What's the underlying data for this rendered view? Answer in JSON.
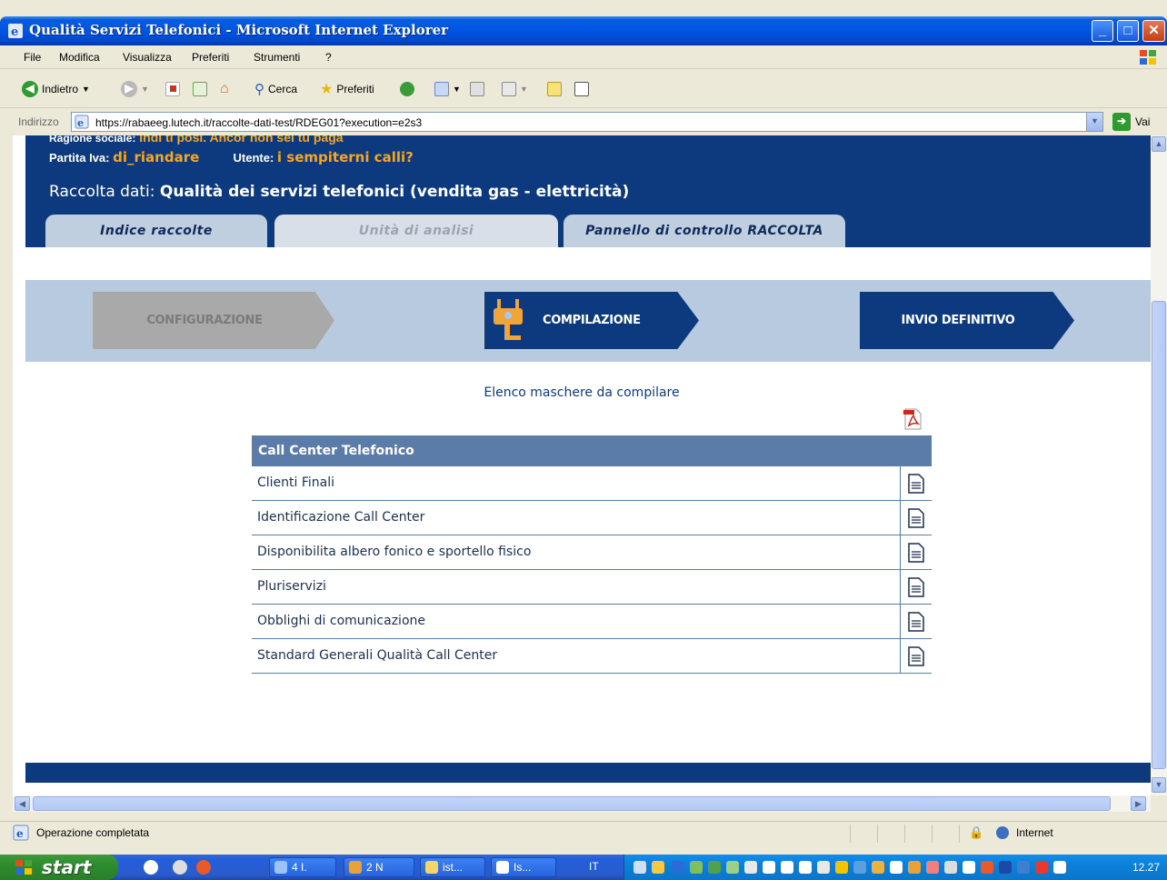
{
  "window": {
    "title": "Qualità Servizi Telefonici - Microsoft Internet Explorer",
    "controls": [
      "_",
      "□",
      "✕"
    ]
  },
  "menu": [
    "File",
    "Modifica",
    "Visualizza",
    "Preferiti",
    "Strumenti",
    "?"
  ],
  "toolbar": {
    "back_label": "Indietro",
    "search_label": "Cerca",
    "favorites_label": "Preferiti"
  },
  "address": {
    "label": "Indirizzo",
    "url": "https://rabaeeg.lutech.it/raccolte-dati-test/RDEG01?execution=e2s3",
    "go_label": "Vai"
  },
  "page": {
    "header": {
      "ragione_label": "Ragione sociale:",
      "ragione_value": "Indi ti posi. Ancor non sei tu paga",
      "partita_label": "Partita Iva:",
      "partita_value": "di_riandare",
      "utente_label": "Utente:",
      "utente_value": "i sempiterni calli?",
      "raccolta_label": "Raccolta dati:",
      "raccolta_value": "Qualità dei servizi telefonici (vendita gas - elettricità)"
    },
    "tabs": [
      {
        "label": "Indice raccolte"
      },
      {
        "label": "Unità di analisi"
      },
      {
        "label": "Pannello di controllo RACCOLTA"
      }
    ],
    "steps": [
      {
        "label": "CONFIGURAZIONE"
      },
      {
        "label": "COMPILAZIONE"
      },
      {
        "label": "INVIO DEFINITIVO"
      }
    ],
    "list_title": "Elenco maschere da compilare",
    "table": {
      "header": "Call Center Telefonico",
      "rows": [
        "Clienti Finali",
        "Identificazione Call Center",
        "Disponibilita albero fonico e sportello fisico",
        "Pluriservizi",
        "Obblighi di comunicazione",
        "Standard Generali Qualità Call Center"
      ]
    }
  },
  "status": {
    "message": "Operazione completata",
    "zone": "Internet"
  },
  "taskbar": {
    "start_label": "start",
    "tasks": [
      "4 I.",
      "2 N",
      "ist...",
      "Is..."
    ],
    "clock": "12.27",
    "lang": "IT"
  },
  "colors": {
    "header_blue": "#0D3A7E",
    "accent_orange": "#F5A623",
    "step_band": "#B8CADF",
    "table_header": "#5B7BA8"
  }
}
